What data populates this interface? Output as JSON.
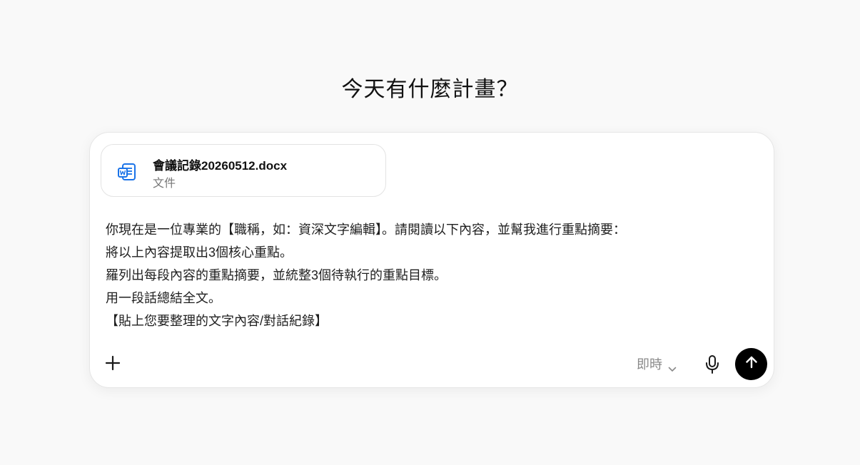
{
  "heading": "今天有什麼計畫？",
  "attachment": {
    "name": "會議記錄20260512.docx",
    "type": "文件",
    "icon": "word-document-icon",
    "icon_color": "#1a73e8"
  },
  "prompt_lines": [
    "你現在是一位專業的【職稱，如：資深文字編輯】。請閱讀以下內容，並幫我進行重點摘要：",
    "將以上內容提取出3個核心重點。",
    "羅列出每段內容的重點摘要，並統整3個待執行的重點目標。",
    "用一段話總結全文。",
    "【貼上您要整理的文字內容/對話紀錄】"
  ],
  "toolbar": {
    "add_icon": "plus-icon",
    "mode_label": "即時",
    "mode_icon": "chevron-down-icon",
    "mic_icon": "microphone-icon",
    "send_icon": "arrow-up-icon",
    "send_color": "#000000"
  }
}
